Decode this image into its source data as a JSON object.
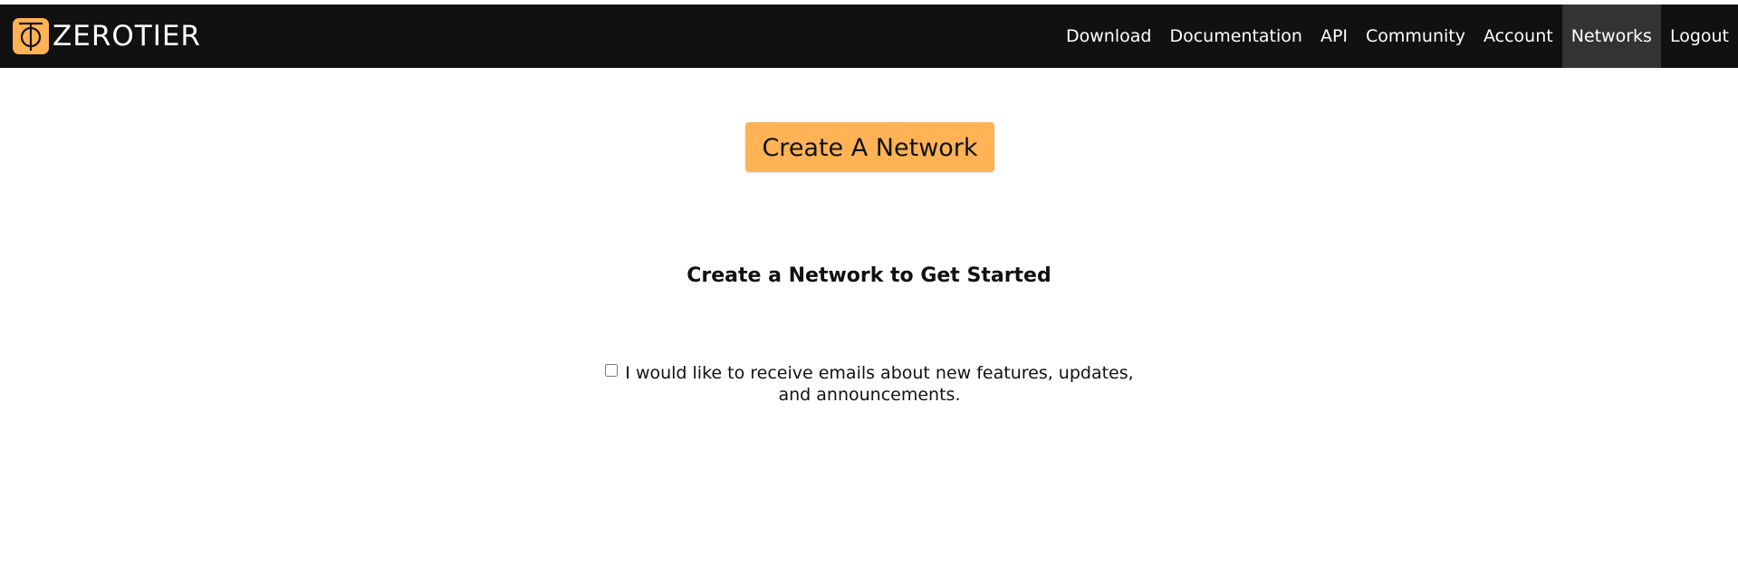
{
  "brand": {
    "logo_icon": "zerotier-logo-icon",
    "name": "ZEROTIER",
    "accent_color": "#ffb354"
  },
  "nav": {
    "items": [
      {
        "label": "Download"
      },
      {
        "label": "Documentation"
      },
      {
        "label": "API"
      },
      {
        "label": "Community"
      },
      {
        "label": "Account"
      },
      {
        "label": "Networks",
        "active": true
      },
      {
        "label": "Logout"
      }
    ]
  },
  "main": {
    "create_button_label": "Create A Network",
    "heading": "Create a Network to Get Started",
    "email_consent": {
      "checked": false,
      "label": "I would like to receive emails about new features, updates, and announcements."
    }
  }
}
